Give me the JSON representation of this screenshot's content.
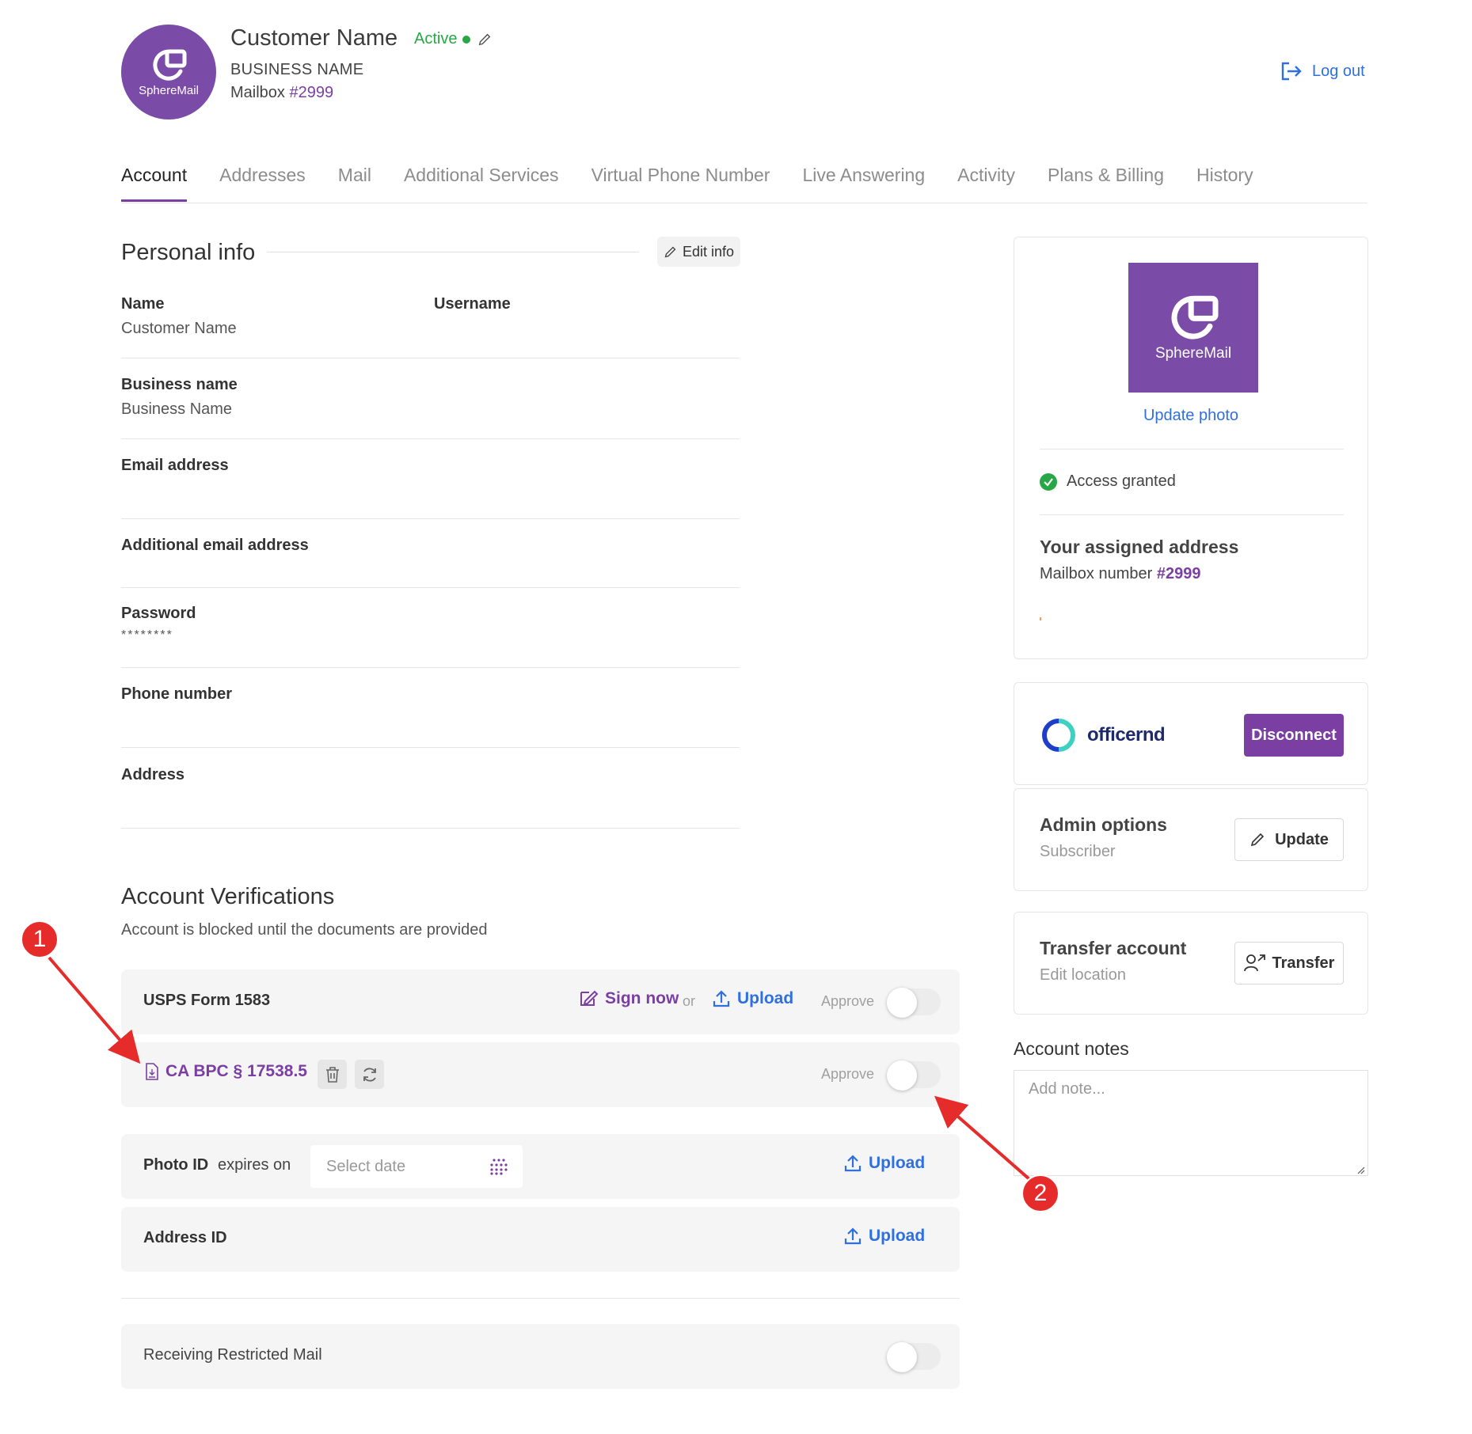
{
  "header": {
    "customer_name": "Customer Name",
    "status": "Active",
    "business_name": "BUSINESS NAME",
    "mailbox_label": "Mailbox",
    "mailbox_number": "#2999",
    "logout_label": "Log out",
    "brand": "SphereMail"
  },
  "tabs": [
    {
      "label": "Account",
      "active": true
    },
    {
      "label": "Addresses"
    },
    {
      "label": "Mail"
    },
    {
      "label": "Additional Services"
    },
    {
      "label": "Virtual Phone Number"
    },
    {
      "label": "Live Answering"
    },
    {
      "label": "Activity"
    },
    {
      "label": "Plans & Billing"
    },
    {
      "label": "History"
    }
  ],
  "personal_info": {
    "title": "Personal info",
    "edit_label": "Edit info",
    "name_label": "Name",
    "name_value": "Customer Name",
    "username_label": "Username",
    "business_label": "Business name",
    "business_value": "Business Name",
    "email_label": "Email address",
    "additional_email_label": "Additional email address",
    "password_label": "Password",
    "password_value": "********",
    "phone_label": "Phone number",
    "address_label": "Address"
  },
  "verifications": {
    "title": "Account Verifications",
    "subtitle": "Account is blocked until the documents are provided",
    "usps_label": "USPS Form 1583",
    "sign_now": "Sign now",
    "or": "or",
    "upload": "Upload",
    "approve": "Approve",
    "ca_doc": "CA BPC § 17538.5",
    "photo_id_label": "Photo ID",
    "expires_on": "expires on",
    "date_placeholder": "Select date",
    "address_id_label": "Address ID",
    "restricted_label": "Receiving Restricted Mail"
  },
  "profile_card": {
    "brand": "SphereMail",
    "update_photo": "Update photo",
    "access_granted": "Access granted",
    "assigned_title": "Your assigned address",
    "mailbox_label": "Mailbox number",
    "mailbox_number": "#2999"
  },
  "officernd": {
    "logo_text": "officernd",
    "disconnect": "Disconnect"
  },
  "admin": {
    "title": "Admin options",
    "subtitle": "Subscriber",
    "update": "Update"
  },
  "transfer": {
    "title": "Transfer account",
    "subtitle": "Edit location",
    "button": "Transfer"
  },
  "notes": {
    "label": "Account notes",
    "placeholder": "Add note..."
  },
  "callouts": [
    "1",
    "2"
  ],
  "colors": {
    "brand_purple": "#7b3fa3",
    "link_blue": "#2f6fe0",
    "active_green": "#27a745",
    "callout_red": "#e62b2b"
  }
}
